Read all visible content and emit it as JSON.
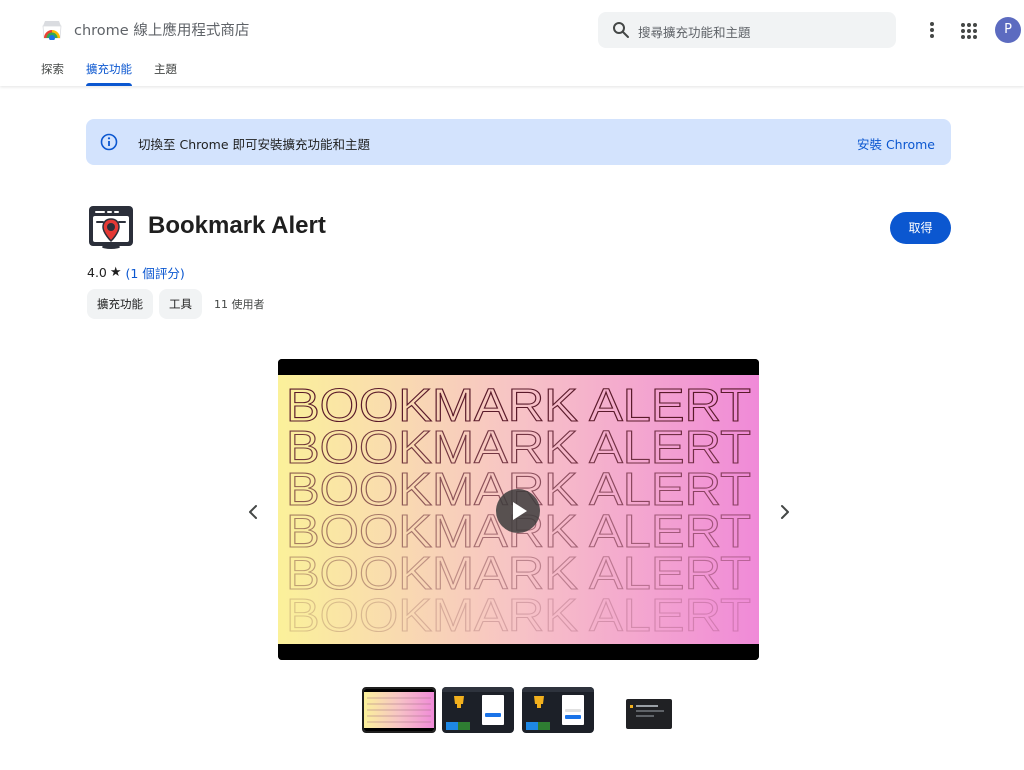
{
  "header": {
    "brand": "chrome 線上應用程式商店",
    "search_placeholder": "搜尋擴充功能和主題",
    "avatar_letter": "P",
    "tabs": [
      {
        "label": "探索",
        "active": false
      },
      {
        "label": "擴充功能",
        "active": true
      },
      {
        "label": "主題",
        "active": false
      }
    ]
  },
  "banner": {
    "message": "切換至 Chrome 即可安裝擴充功能和主題",
    "install_link": "安裝 Chrome"
  },
  "item": {
    "title": "Bookmark Alert",
    "get_button": "取得",
    "rating_value": "4.0",
    "rating_count": "(1 個評分)",
    "chips": [
      "擴充功能",
      "工具"
    ],
    "users": "11 使用者"
  },
  "media": {
    "video_text": "BOOKMARK ALERT",
    "gradient_colors": [
      "#fbf19a",
      "#f7c3c6",
      "#f08ad8"
    ],
    "thumbnail_count": 4,
    "selected_thumbnail": 1
  },
  "colors": {
    "accent": "#0b57d0",
    "banner_bg": "#d3e3fd",
    "chip_bg": "#f1f3f4"
  }
}
